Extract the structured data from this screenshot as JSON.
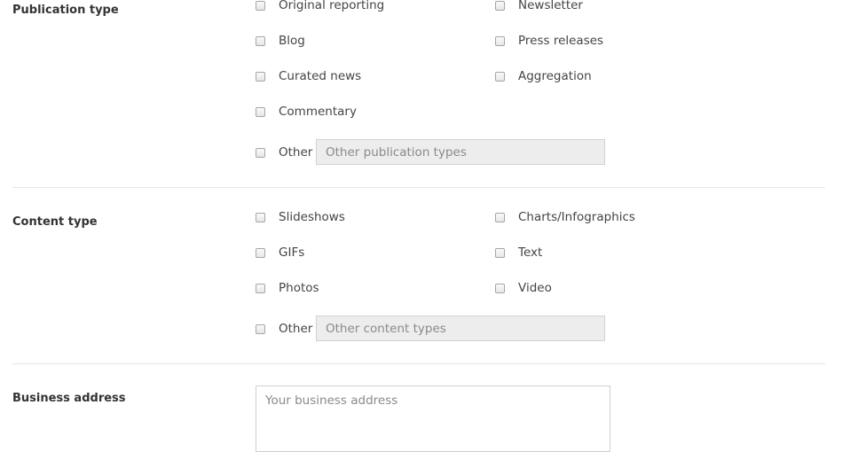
{
  "publication_type": {
    "label": "Publication type",
    "options": [
      "Original reporting",
      "Newsletter",
      "Blog",
      "Press releases",
      "Curated news",
      "Aggregation",
      "Commentary"
    ],
    "other_label": "Other",
    "other_placeholder": "Other publication types"
  },
  "content_type": {
    "label": "Content type",
    "options": [
      "Slideshows",
      "Charts/Infographics",
      "GIFs",
      "Text",
      "Photos",
      "Video"
    ],
    "other_label": "Other",
    "other_placeholder": "Other content types"
  },
  "business_address": {
    "label": "Business address",
    "placeholder": "Your business address"
  }
}
